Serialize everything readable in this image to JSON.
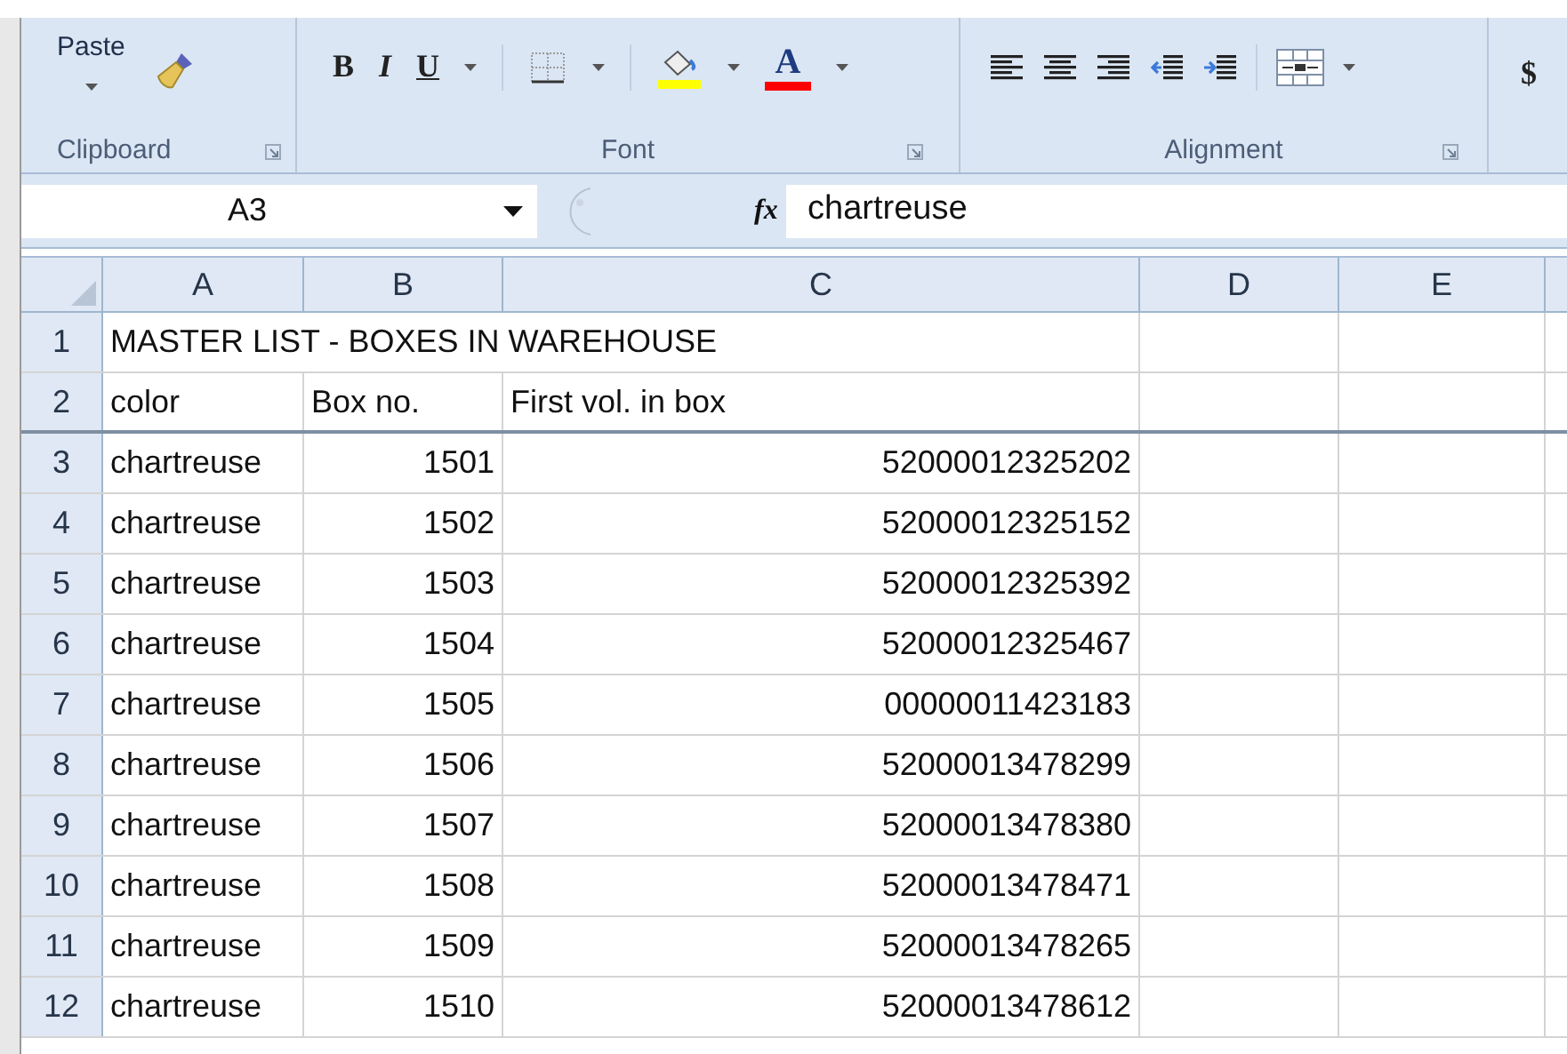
{
  "ribbon": {
    "clipboard": {
      "paste_label": "Paste",
      "group_label": "Clipboard"
    },
    "font": {
      "style_buttons": [
        {
          "label": "B",
          "kind": "bold"
        },
        {
          "label": "I",
          "kind": "italic"
        },
        {
          "label": "U",
          "kind": "underline"
        }
      ],
      "font_color_label": "A",
      "group_label": "Font"
    },
    "alignment": {
      "group_label": "Alignment"
    },
    "number": {
      "currency_label": "$"
    }
  },
  "formula_bar": {
    "name_box": "A3",
    "fx_label": "fx",
    "value": "chartreuse"
  },
  "grid": {
    "columns": [
      {
        "label": "A"
      },
      {
        "label": "B"
      },
      {
        "label": "C"
      },
      {
        "label": "D"
      },
      {
        "label": "E"
      }
    ],
    "rows": [
      {
        "number": "1",
        "cells": [
          "MASTER LIST - BOXES IN WAREHOUSE"
        ],
        "kind": "title"
      },
      {
        "number": "2",
        "cells": [
          "color",
          "Box no.",
          "First vol. in box"
        ],
        "kind": "header"
      },
      {
        "number": "3",
        "cells": [
          "chartreuse",
          "1501",
          "52000012325202"
        ],
        "kind": "data"
      },
      {
        "number": "4",
        "cells": [
          "chartreuse",
          "1502",
          "52000012325152"
        ],
        "kind": "data"
      },
      {
        "number": "5",
        "cells": [
          "chartreuse",
          "1503",
          "52000012325392"
        ],
        "kind": "data"
      },
      {
        "number": "6",
        "cells": [
          "chartreuse",
          "1504",
          "52000012325467"
        ],
        "kind": "data"
      },
      {
        "number": "7",
        "cells": [
          "chartreuse",
          "1505",
          "00000011423183"
        ],
        "kind": "data"
      },
      {
        "number": "8",
        "cells": [
          "chartreuse",
          "1506",
          "52000013478299"
        ],
        "kind": "data"
      },
      {
        "number": "9",
        "cells": [
          "chartreuse",
          "1507",
          "52000013478380"
        ],
        "kind": "data"
      },
      {
        "number": "10",
        "cells": [
          "chartreuse",
          "1508",
          "52000013478471"
        ],
        "kind": "data"
      },
      {
        "number": "11",
        "cells": [
          "chartreuse",
          "1509",
          "52000013478265"
        ],
        "kind": "data"
      },
      {
        "number": "12",
        "cells": [
          "chartreuse",
          "1510",
          "52000013478612"
        ],
        "kind": "data"
      }
    ]
  }
}
